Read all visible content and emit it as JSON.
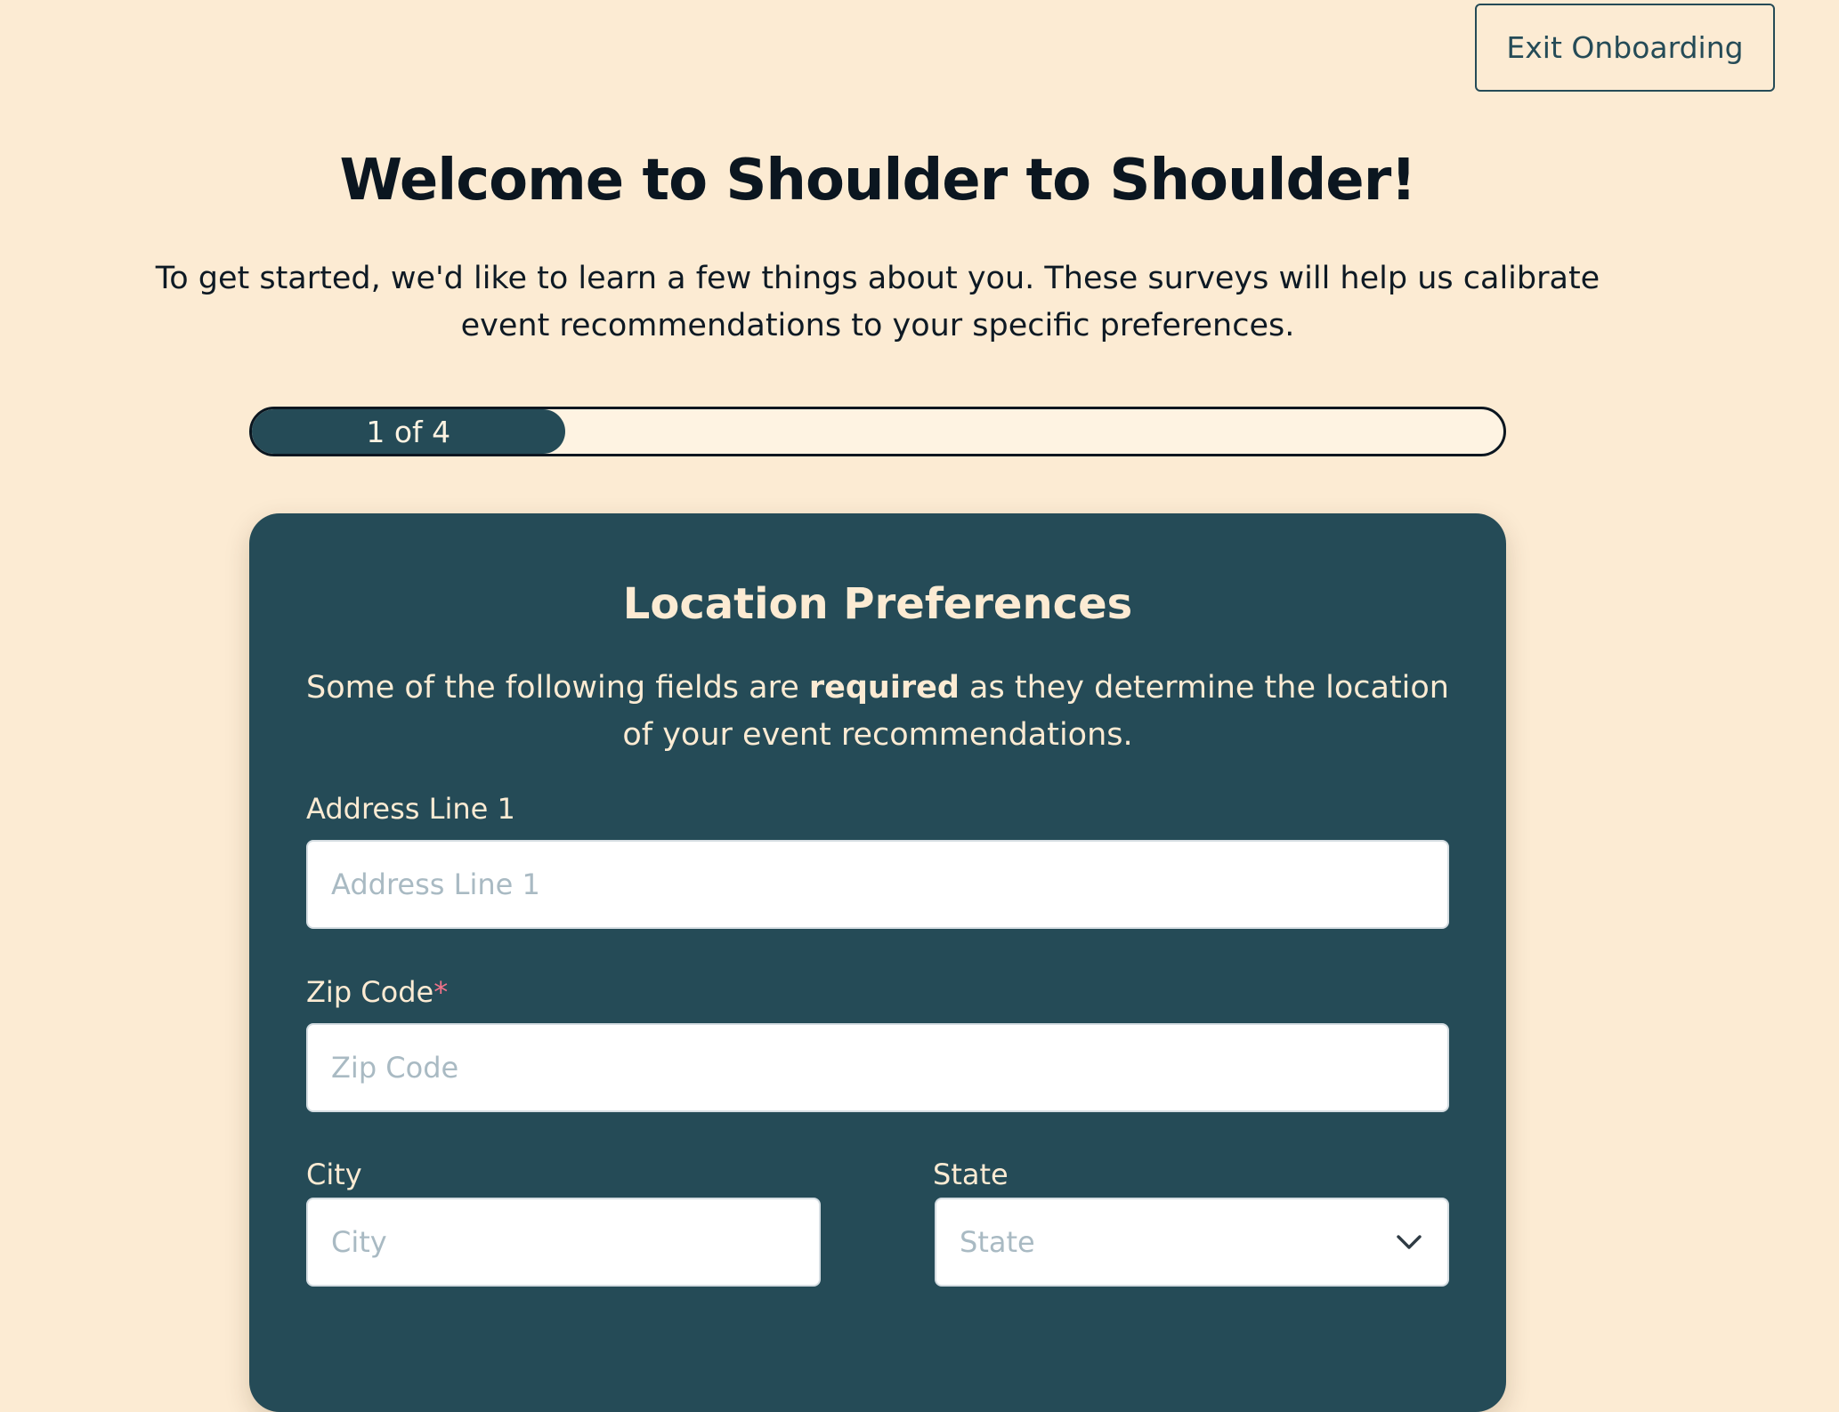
{
  "header": {
    "exit_label": "Exit Onboarding"
  },
  "welcome": {
    "title": "Welcome to Shoulder to Shoulder!",
    "intro": "To get started, we'd like to learn a few things about you. These surveys will help us calibrate event recommendations to your specific preferences."
  },
  "progress": {
    "label": "1 of 4",
    "current_step": 1,
    "total_steps": 4,
    "fraction": 0.25
  },
  "form": {
    "title": "Location Preferences",
    "desc_before": "Some of the following fields are ",
    "desc_bold": "required",
    "desc_after": " as they determine the location of your event recommendations.",
    "address": {
      "label": "Address Line 1",
      "placeholder": "Address Line 1",
      "value": ""
    },
    "zip": {
      "label": "Zip Code",
      "required_mark": "*",
      "placeholder": "Zip Code",
      "value": ""
    },
    "city": {
      "label": "City",
      "placeholder": "City",
      "value": ""
    },
    "state": {
      "label": "State",
      "selected": "State"
    }
  },
  "colors": {
    "background": "#FCEBD3",
    "primary": "#254B57",
    "text_dark": "#0B1620",
    "required": "#F2728A"
  },
  "icons": {
    "state_dropdown": "chevron-down-icon"
  }
}
